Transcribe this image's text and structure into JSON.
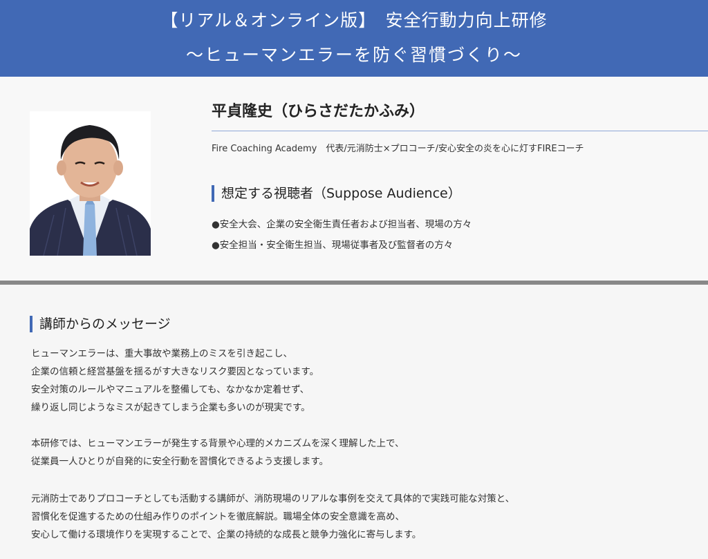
{
  "header": {
    "line1": "【リアル＆オンライン版】　安全行動力向上研修",
    "line2": "～ヒューマンエラーを防ぐ習慣づくり～"
  },
  "profile": {
    "photo_alt": "講師写真",
    "name": "平貞隆史（ひらさだたかふみ）",
    "affiliation": "Fire Coaching Academy　代表/元消防士×プロコーチ/安心安全の炎を心に灯すFIREコーチ",
    "audience_title": "想定する視聴者（Suppose Audience）",
    "audience_items": [
      "●安全大会、企業の安全衛生責任者および担当者、現場の方々",
      "●安全担当・安全衛生担当、現場従事者及び監督者の方々"
    ]
  },
  "message": {
    "title": "講師からのメッセージ",
    "lines": [
      "ヒューマンエラーは、重大事故や業務上のミスを引き起こし、",
      "企業の信頼と経営基盤を揺るがす大きなリスク要因となっています。",
      "安全対策のルールやマニュアルを整備しても、なかなか定着せず、",
      "繰り返し同じようなミスが起きてしまう企業も多いのが現実です。",
      "本研修では、ヒューマンエラーが発生する背景や心理的メカニズムを深く理解した上で、",
      "従業員一人ひとりが自発的に安全行動を習慣化できるよう支援します。",
      "元消防士でありプロコーチとしても活動する講師が、消防現場のリアルな事例を交えて具体的で実践可能な対策と、",
      "習慣化を促進するための仕組み作りのポイントを徹底解説。職場全体の安全意識を高め、",
      "安心して働ける環境作りを実現することで、企業の持続的な成長と競争力強化に寄与します。"
    ]
  },
  "colors": {
    "header_bg": "#4169b5",
    "accent": "#4169b5",
    "divider": "#888888"
  }
}
